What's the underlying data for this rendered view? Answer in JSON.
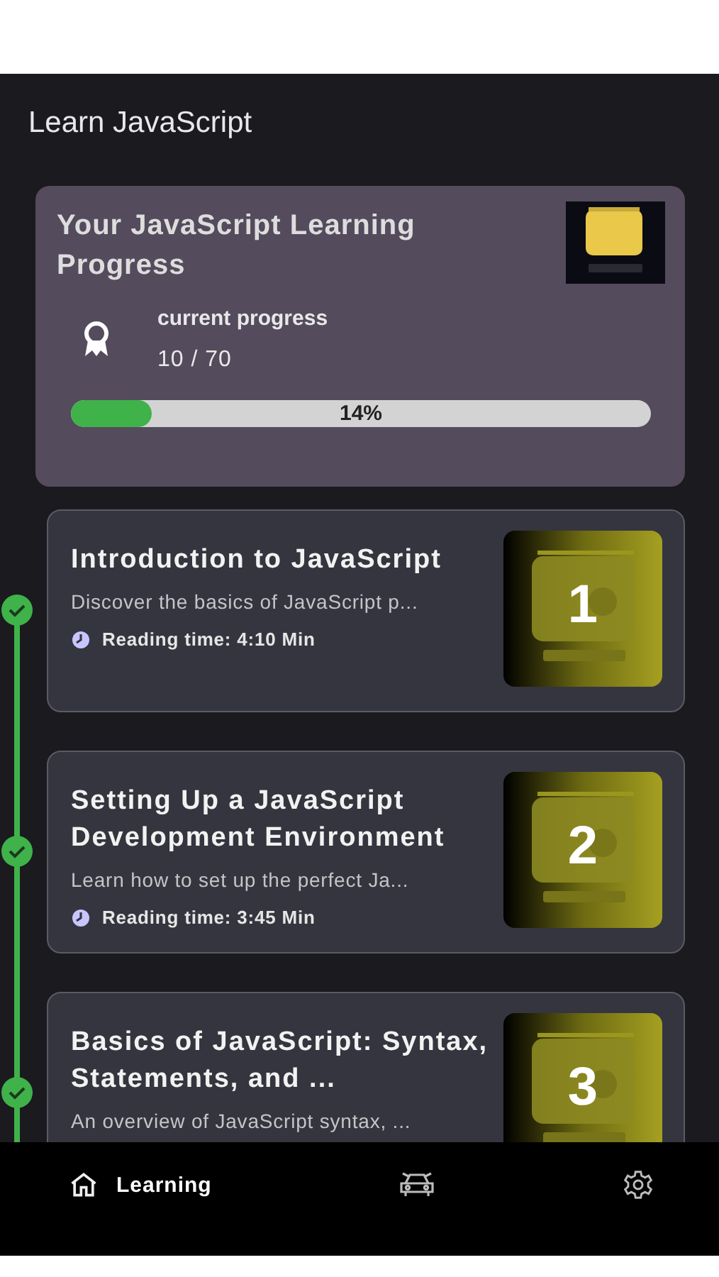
{
  "header": {
    "title": "Learn JavaScript"
  },
  "progress": {
    "title": "Your JavaScript Learning Progress",
    "label": "current progress",
    "count": "10 / 70",
    "level": 0.14,
    "percent": "14%"
  },
  "lessons": [
    {
      "number": "1",
      "title": "Introduction to JavaScript",
      "description": "Discover the basics of JavaScript p...",
      "reading_time": "Reading time: 4:10 Min",
      "completed": true
    },
    {
      "number": "2",
      "title": "Setting Up a JavaScript Development Environment",
      "description": "Learn how to set up the perfect Ja...",
      "reading_time": "Reading time: 3:45 Min",
      "completed": true
    },
    {
      "number": "3",
      "title": "Basics of JavaScript: Syntax, Statements, and ...",
      "description": "An overview of JavaScript syntax, ...",
      "completed": true
    }
  ],
  "nav": [
    {
      "label": "Learning",
      "selected": true
    },
    {
      "selected": false
    },
    {
      "selected": false
    }
  ]
}
